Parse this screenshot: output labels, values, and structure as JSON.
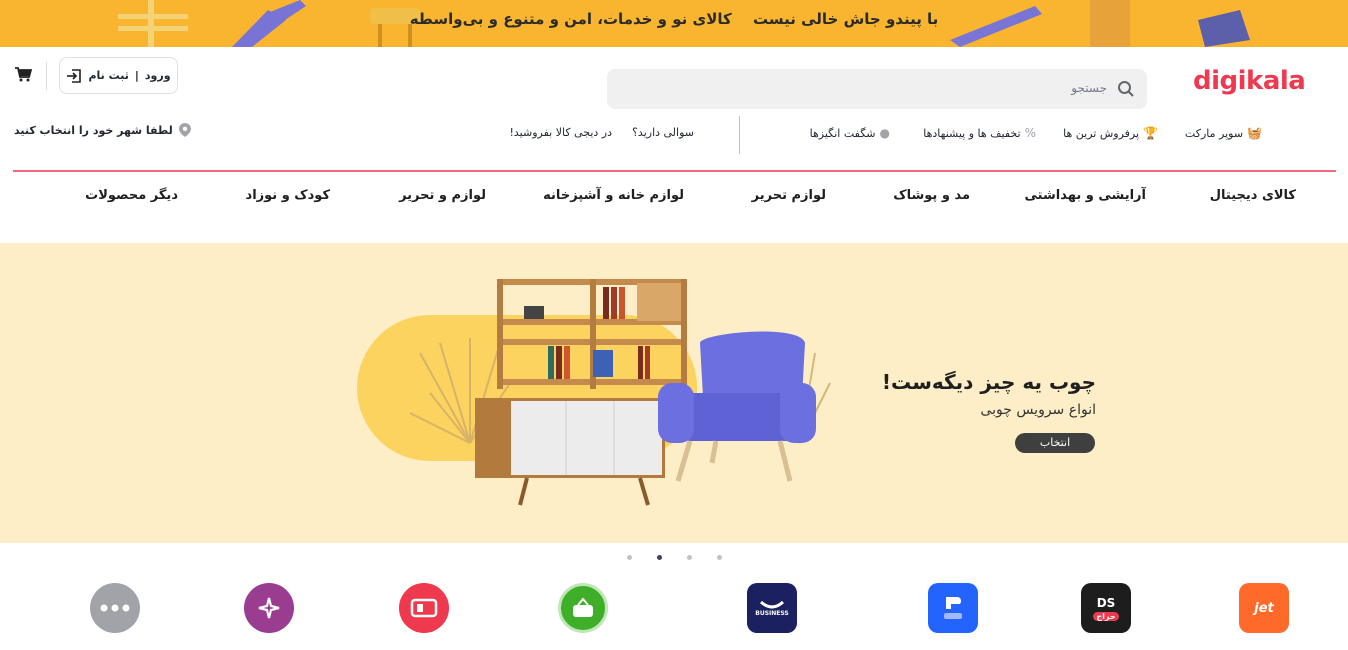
{
  "promo": {
    "text_a": "با پیندو جاش خالی نیست",
    "text_b": "کالای نو و خدمات، امن و متنوع و بی‌واسطه",
    "bg": "#f9b52f"
  },
  "header": {
    "logo": "digikala",
    "search_placeholder": "جستجو",
    "login_label": "ورود",
    "register_label": "ثبت نام",
    "separator": "|",
    "city_label": "لطفا شهر خود را انتخاب کنید"
  },
  "subnav": {
    "items": [
      {
        "label": "سوپر مارکت",
        "icon": "basket-icon"
      },
      {
        "label": "پرفروش ترین ها",
        "icon": "trophy-icon"
      },
      {
        "label": "تخفیف ها و پیشنهادها",
        "icon": "percent-icon"
      },
      {
        "label": "شگفت انگیزها",
        "icon": "flame-icon"
      },
      {
        "label": "سوالی دارید؟"
      },
      {
        "label": "در دیجی کالا بفروشید!"
      }
    ]
  },
  "categories": [
    "کالای دیجیتال",
    "آرایشی و بهداشتی",
    "مد و پوشاک",
    "لوازم تحریر",
    "لوازم خانه و آشپزخانه",
    "لوازم و تحریر",
    "کودک و نوزاد",
    "دیگر محصولات"
  ],
  "hero": {
    "title": "چوب یه چیز دیگه‌ست!",
    "subtitle": "انواع سرویس چوبی",
    "button": "انتخاب",
    "bg": "#fdeec8"
  },
  "carousel": {
    "count": 4,
    "active_index": 1
  },
  "services": [
    {
      "name": "jet",
      "label": "jet",
      "color": "#ff6a2b"
    },
    {
      "name": "ds-haraj",
      "label": "DS",
      "badge": "حراج",
      "color": "#1d1d1d"
    },
    {
      "name": "digipay",
      "label": "",
      "color": "#2364ff"
    },
    {
      "name": "business",
      "label": "BUSINESS",
      "color": "#1a2060"
    },
    {
      "name": "supermarket",
      "label": "%",
      "color": "#3fae29"
    },
    {
      "name": "gift-card",
      "label": "",
      "color": "#ef394e"
    },
    {
      "name": "club",
      "label": "",
      "color": "#9a3d91"
    },
    {
      "name": "more",
      "label": "",
      "color": "#a1a3a8"
    }
  ]
}
